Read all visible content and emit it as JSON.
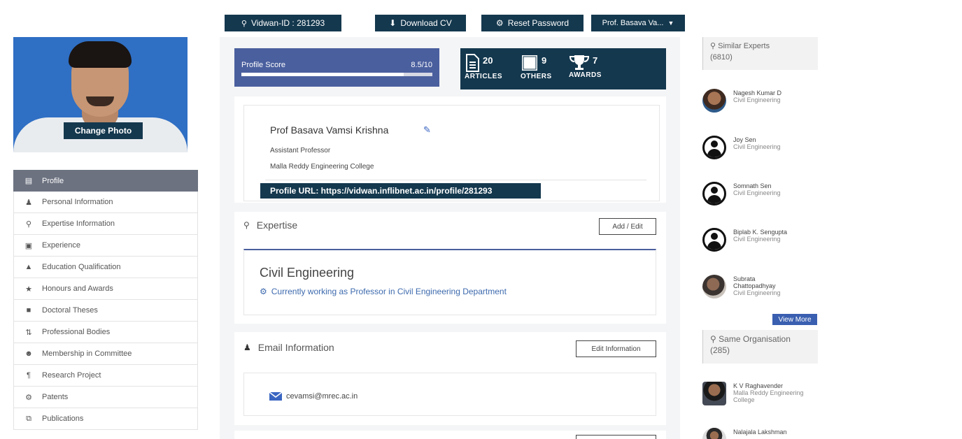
{
  "topbar": {
    "vidwan_id": "Vidwan-ID : 281293",
    "download_cv": "Download CV",
    "reset_password": "Reset Password",
    "user_menu": "Prof. Basava Va..."
  },
  "photo": {
    "change_photo": "Change Photo"
  },
  "sidebar": {
    "items": [
      {
        "label": "Profile",
        "icon": "monitor-icon",
        "active": true
      },
      {
        "label": "Personal Information",
        "icon": "user-icon"
      },
      {
        "label": "Expertise Information",
        "icon": "lightbulb-icon"
      },
      {
        "label": "Experience",
        "icon": "briefcase-icon"
      },
      {
        "label": "Education Qualification",
        "icon": "graduation-cap-icon"
      },
      {
        "label": "Honours and Awards",
        "icon": "trophy-icon"
      },
      {
        "label": "Doctoral Theses",
        "icon": "book-icon"
      },
      {
        "label": "Professional Bodies",
        "icon": "sort-icon"
      },
      {
        "label": "Membership in Committee",
        "icon": "users-icon"
      },
      {
        "label": "Research Project",
        "icon": "paragraph-icon"
      },
      {
        "label": "Patents",
        "icon": "gears-icon"
      },
      {
        "label": "Publications",
        "icon": "copy-icon"
      }
    ]
  },
  "score": {
    "label": "Profile Score",
    "value": "8.5/10",
    "fraction": 0.85
  },
  "stats": [
    {
      "count": "20",
      "label": "ARTICLES",
      "icon": "document-icon"
    },
    {
      "count": "9",
      "label": "OTHERS",
      "icon": "book-icon"
    },
    {
      "count": "7",
      "label": "AWARDS",
      "icon": "trophy-icon"
    }
  ],
  "profile": {
    "name": "Prof Basava Vamsi Krishna",
    "designation": "Assistant Professor",
    "organisation": "Malla Reddy Engineering College",
    "url": "Profile URL: https://vidwan.inflibnet.ac.in/profile/281293"
  },
  "expertise": {
    "title": "Expertise",
    "button": "Add / Edit",
    "area": "Civil Engineering",
    "description": "Currently working as Professor in Civil Engineering Department"
  },
  "email": {
    "title": "Email Information",
    "button": "Edit Information",
    "address": "cevamsi@mrec.ac.in"
  },
  "similar": {
    "title": "Similar Experts",
    "count": "(6810)",
    "experts": [
      {
        "name": "Nagesh Kumar D",
        "dept": "Civil Engineering",
        "avatar": "photo1"
      },
      {
        "name": "Joy Sen",
        "dept": "Civil Engineering",
        "avatar": "user"
      },
      {
        "name": "Somnath Sen",
        "dept": "Civil Engineering",
        "avatar": "user"
      },
      {
        "name": "Biplab K. Sengupta",
        "dept": "Civil Engineering",
        "avatar": "user"
      },
      {
        "name": "Subrata Chattopadhyay",
        "dept": "Civil Engineering",
        "avatar": "photo2"
      }
    ],
    "view_more": "View More"
  },
  "same_org": {
    "title": "Same Organisation",
    "count": "(285)",
    "experts": [
      {
        "name": "K V Raghavender",
        "dept": "Malla Reddy Engineering College",
        "avatar": "photo3"
      },
      {
        "name": "Nalajala Lakshman",
        "dept": "",
        "avatar": "photo4"
      }
    ]
  }
}
